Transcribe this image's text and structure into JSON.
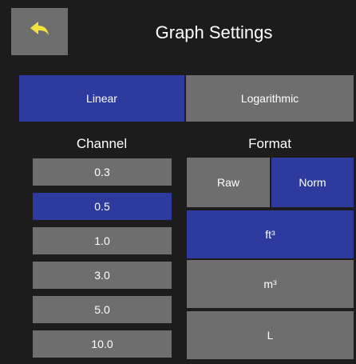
{
  "header": {
    "title": "Graph Settings",
    "back_icon": "back-arrow-icon",
    "back_icon_color": "#f2e23c"
  },
  "scale": {
    "options": [
      "Linear",
      "Logarithmic"
    ],
    "selected": "Linear"
  },
  "channel": {
    "label": "Channel",
    "options": [
      "0.3",
      "0.5",
      "1.0",
      "3.0",
      "5.0",
      "10.0"
    ],
    "selected": "0.5"
  },
  "format": {
    "label": "Format",
    "mode_options": [
      "Raw",
      "Norm"
    ],
    "mode_selected": "Norm",
    "unit_options": [
      "ft³",
      "m³",
      "L"
    ],
    "unit_selected": "ft³"
  },
  "colors": {
    "background": "#1c1c1c",
    "button_gray": "#6e6e6e",
    "selected_blue": "#2d3a9e",
    "text": "#ffffff"
  }
}
